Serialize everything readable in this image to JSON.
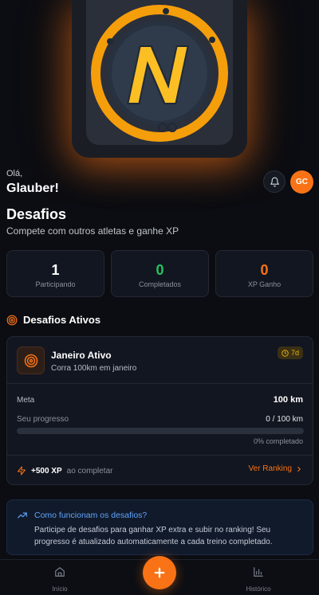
{
  "colors": {
    "accent": "#f97316",
    "success": "#22c55e",
    "info": "#60a5fa",
    "warning": "#eab308",
    "background": "#0b0d12"
  },
  "header": {
    "greeting": "Olá,",
    "user_name": "Glauber!",
    "avatar_initials": "GC",
    "bell_icon": "bell-icon"
  },
  "page": {
    "title": "Desafios",
    "subtitle": "Compete com outros atletas e ganhe XP"
  },
  "stats": [
    {
      "value": "1",
      "label": "Participando",
      "color": "#ffffff"
    },
    {
      "value": "0",
      "label": "Completados",
      "color": "#22c55e"
    },
    {
      "value": "0",
      "label": "XP Ganho",
      "color": "#f97316"
    }
  ],
  "section": {
    "title": "Desafios Ativos",
    "icon": "target-icon"
  },
  "challenge": {
    "title": "Janeiro Ativo",
    "description": "Corra 100km em janeiro",
    "days_left": "7d",
    "goal_label": "Meta",
    "goal_value": "100 km",
    "progress_label": "Seu progresso",
    "progress_value": "0 / 100 km",
    "progress_fraction": 0,
    "percent_label": "0% completado",
    "xp_reward": "+500 XP",
    "xp_suffix": "ao completar",
    "ranking_link": "Ver Ranking"
  },
  "info": {
    "title": "Como funcionam os desafios?",
    "text": "Participe de desafios para ganhar XP extra e subir no ranking! Seu progresso é atualizado automaticamente a cada treino completado."
  },
  "nav": {
    "home_label": "Início",
    "history_label": "Histórico",
    "fab_icon": "plus-icon"
  }
}
